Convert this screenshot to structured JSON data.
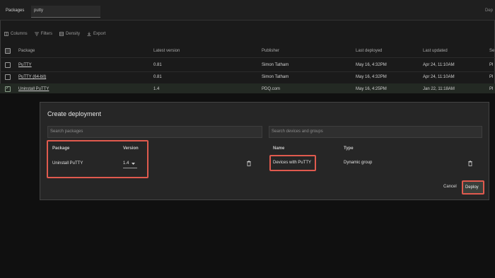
{
  "topbar": {
    "title": "Packages",
    "search_value": "putty",
    "right_text": "Dep"
  },
  "toolbar": {
    "columns": "Columns",
    "filters": "Filters",
    "density": "Density",
    "export": "Export"
  },
  "table": {
    "headers": [
      "Package",
      "Latest version",
      "Publisher",
      "Last deployed",
      "Last updated",
      "Se"
    ],
    "rows": [
      {
        "package": "PuTTY",
        "version": "0.81",
        "publisher": "Simon Tatham",
        "deployed": "May 16, 4:32PM",
        "updated": "Apr 24, 11:10AM",
        "extra": "Pl"
      },
      {
        "package": "PuTTY (64-bit)",
        "version": "0.81",
        "publisher": "Simon Tatham",
        "deployed": "May 16, 4:32PM",
        "updated": "Apr 24, 11:10AM",
        "extra": "Pl"
      },
      {
        "package": "Uninstall PuTTY",
        "version": "1.4",
        "publisher": "PDQ.com",
        "deployed": "May 16, 4:25PM",
        "updated": "Jan 22, 11:18AM",
        "extra": "Pl"
      }
    ]
  },
  "dialog": {
    "title": "Create deployment",
    "packages_search_placeholder": "Search packages",
    "targets_search_placeholder": "Search devices and groups",
    "package_header": "Package",
    "version_header": "Version",
    "package_value": "Uninstall PuTTY",
    "version_value": "1.4",
    "name_header": "Name",
    "type_header": "Type",
    "target_name": "Devices with PuTTY",
    "target_type": "Dynamic group",
    "cancel_label": "Cancel",
    "deploy_label": "Deploy"
  },
  "colors": {
    "highlight": "#e05a4e",
    "background": "#1a1a1a",
    "dialog": "#262626"
  },
  "icons": [
    "columns-icon",
    "filters-icon",
    "density-icon",
    "export-icon",
    "chevron-down-icon",
    "trash-icon"
  ]
}
